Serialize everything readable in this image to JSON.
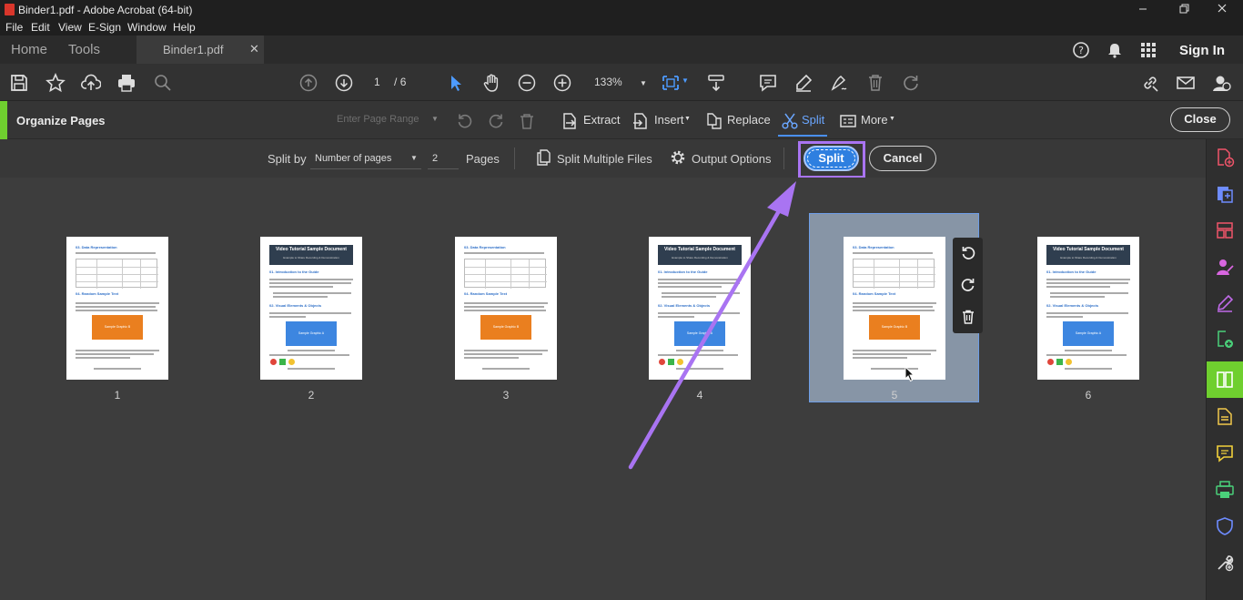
{
  "window": {
    "title": "Binder1.pdf - Adobe Acrobat (64-bit)"
  },
  "menu": [
    "File",
    "Edit",
    "View",
    "E-Sign",
    "Window",
    "Help"
  ],
  "tabs": {
    "home": "Home",
    "tools": "Tools",
    "file": "Binder1.pdf",
    "sign_in": "Sign In"
  },
  "toolbar": {
    "page_current": "1",
    "page_total": "/ 6",
    "zoom": "133%"
  },
  "organize": {
    "title": "Organize Pages",
    "range_placeholder": "Enter Page Range",
    "extract": "Extract",
    "insert": "Insert",
    "replace": "Replace",
    "split": "Split",
    "more": "More",
    "close": "Close"
  },
  "split_bar": {
    "split_by_label": "Split by",
    "split_by_value": "Number of pages",
    "pages_value": "2",
    "pages_label": "Pages",
    "multiple_files": "Split Multiple Files",
    "output_options": "Output Options",
    "split_button": "Split",
    "cancel_button": "Cancel"
  },
  "pages": [
    {
      "number": "1",
      "kind": "table",
      "selected": false
    },
    {
      "number": "2",
      "kind": "title",
      "selected": false
    },
    {
      "number": "3",
      "kind": "table",
      "selected": false
    },
    {
      "number": "4",
      "kind": "title",
      "selected": false
    },
    {
      "number": "5",
      "kind": "table",
      "selected": true
    },
    {
      "number": "6",
      "kind": "title",
      "selected": false
    }
  ],
  "thumb_text": {
    "title_doc": "Video Tutorial Sample Document",
    "title_sub": "Example to Share Recording & Demonstration",
    "sec_data": "03. Data Representation",
    "sec_intro": "01. Introduction to the Guide",
    "sec_random": "04. Random Sample Text",
    "sec_visual": "02. Visual Elements & Objects",
    "caption_a": "Sample Graphic A",
    "caption_b": "Sample Graphic B"
  },
  "colors": {
    "accent_green": "#6fcf2f",
    "split_blue": "#2e7fe0",
    "highlight_purple": "#a974f2"
  },
  "icons": {
    "toolbar": [
      "save-icon",
      "star-icon",
      "upload-icon",
      "print-icon",
      "search-icon",
      "prev-page-icon",
      "next-page-icon",
      "select-icon",
      "hand-icon",
      "zoom-out-icon",
      "zoom-in-icon",
      "fit-page-icon",
      "scroll-icon",
      "comment-icon",
      "highlight-icon",
      "sign-icon",
      "delete-icon",
      "redo-icon",
      "link-icon",
      "email-icon",
      "account-icon"
    ],
    "right_panel": [
      "export-pdf-icon",
      "create-pdf-icon",
      "edit-pdf-icon",
      "request-signature-icon",
      "fill-sign-icon",
      "combine-files-icon",
      "organize-pages-icon",
      "scan-ocr-icon",
      "comment-icon",
      "print-production-icon",
      "protect-icon",
      "more-tools-icon"
    ]
  }
}
